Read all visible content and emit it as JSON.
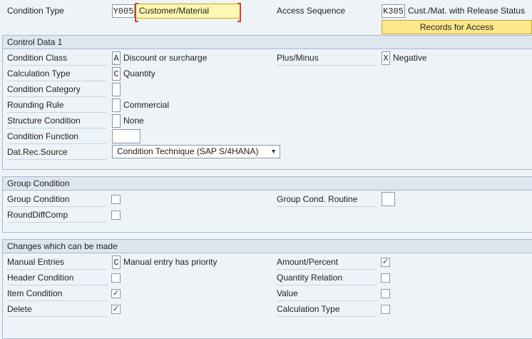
{
  "header": {
    "condition_type_label": "Condition Type",
    "condition_type_code": "Y005",
    "condition_type_desc": "Customer/Material",
    "access_sequence_label": "Access Sequence",
    "access_sequence_code": "K305",
    "access_sequence_desc": "Cust./Mat. with Release Status",
    "records_button": "Records for Access"
  },
  "control_data": {
    "title": "Control Data 1",
    "condition_class_label": "Condition Class",
    "condition_class_code": "A",
    "condition_class_desc": "Discount or surcharge",
    "plus_minus_label": "Plus/Minus",
    "plus_minus_code": "X",
    "plus_minus_desc": "Negative",
    "calc_type_label": "Calculation Type",
    "calc_type_code": "C",
    "calc_type_desc": "Quantity",
    "category_label": "Condition Category",
    "rounding_label": "Rounding Rule",
    "rounding_desc": "Commercial",
    "structure_label": "Structure Condition",
    "structure_desc": "None",
    "function_label": "Condition Function",
    "datrec_label": "Dat.Rec.Source",
    "datrec_value": "Condition Technique (SAP S/4HANA)"
  },
  "group_condition": {
    "title": "Group Condition",
    "group_condition_label": "Group Condition",
    "group_cond_routine_label": "Group Cond. Routine",
    "rounddiff_label": "RoundDiffComp"
  },
  "changes": {
    "title": "Changes which can be made",
    "manual_entries_label": "Manual Entries",
    "manual_entries_code": "C",
    "manual_entries_desc": "Manual entry has priority",
    "amount_percent_label": "Amount/Percent",
    "header_condition_label": "Header Condition",
    "quantity_relation_label": "Quantity Relation",
    "item_condition_label": "Item Condition",
    "value_label": "Value",
    "delete_label": "Delete",
    "calc_type_label": "Calculation Type",
    "check_mark": "✓"
  }
}
